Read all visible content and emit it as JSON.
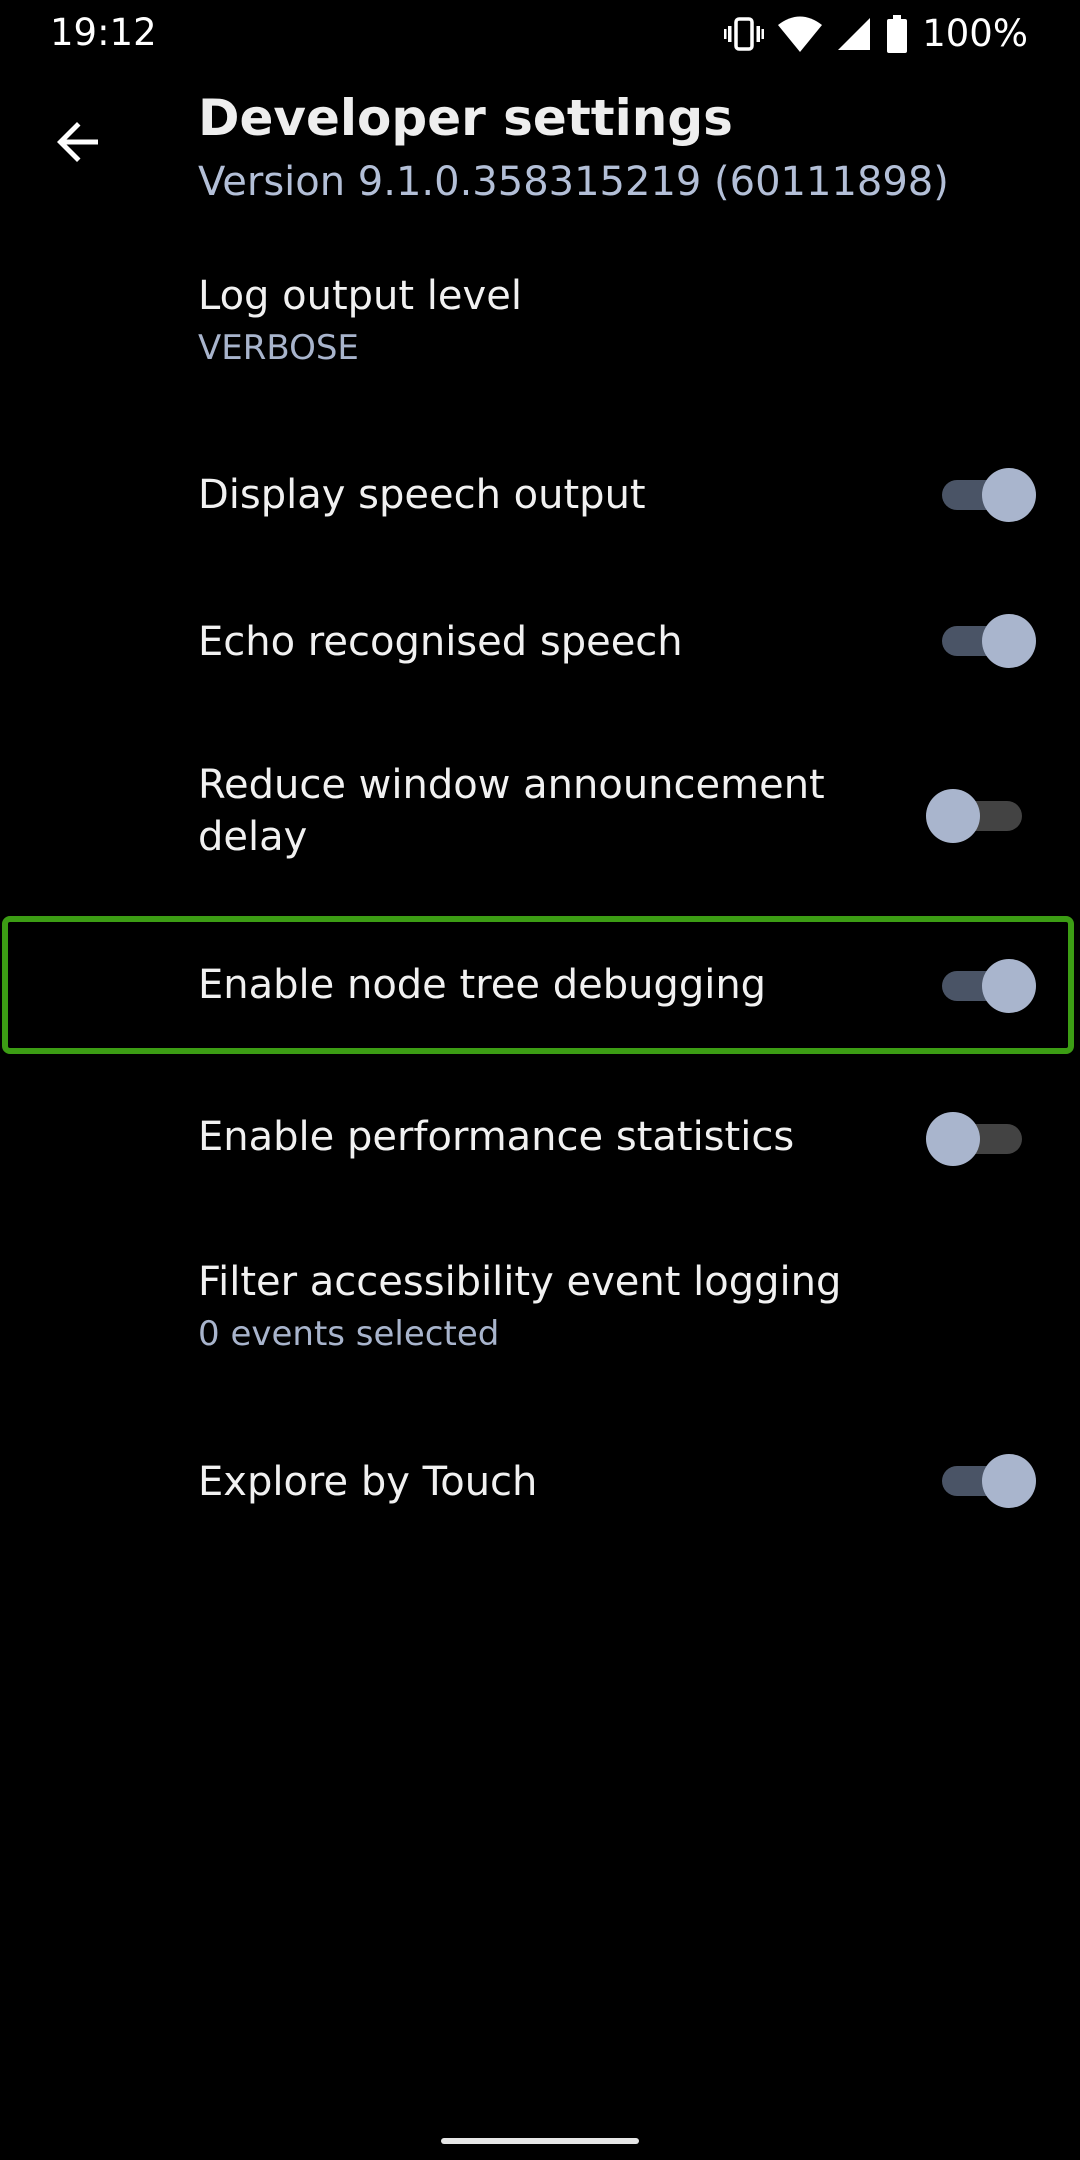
{
  "status_bar": {
    "time": "19:12",
    "battery": "100%",
    "icons": [
      "vibrate-icon",
      "wifi-icon",
      "cell-signal-icon",
      "battery-icon"
    ]
  },
  "header": {
    "back_icon": "arrow-left-icon",
    "title": "Developer settings",
    "subtitle": "Version 9.1.0.358315219 (60111898)"
  },
  "settings": [
    {
      "title": "Log output level",
      "summary": "VERBOSE"
    },
    {
      "title": "Display speech output",
      "switch": "on"
    },
    {
      "title": "Echo recognised speech",
      "switch": "on"
    },
    {
      "title": "Reduce window announcement delay",
      "switch": "off"
    },
    {
      "title": "Enable node tree debugging",
      "switch": "on",
      "highlighted": true
    },
    {
      "title": "Enable performance statistics",
      "switch": "off"
    },
    {
      "title": "Filter accessibility event logging",
      "summary": "0 events selected"
    },
    {
      "title": "Explore by Touch",
      "switch": "on"
    }
  ],
  "colors": {
    "background": "#000000",
    "summary_text": "#a8b4cc",
    "switch_thumb": "#a9b5cd",
    "highlight": "#3c9d14"
  }
}
